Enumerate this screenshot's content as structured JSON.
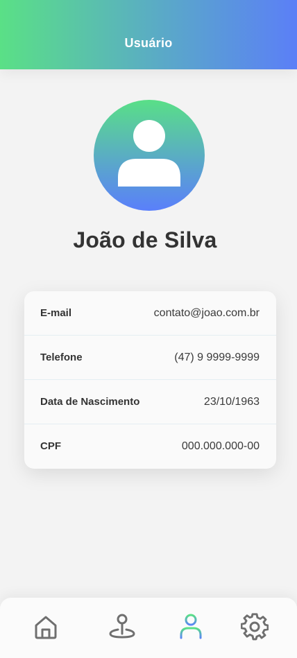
{
  "header": {
    "title": "Usuário"
  },
  "profile": {
    "avatar_icon": "user-avatar-icon",
    "name": "João de Silva"
  },
  "details": {
    "rows": [
      {
        "label": "E-mail",
        "value": "contato@joao.com.br"
      },
      {
        "label": "Telefone",
        "value": "(47) 9 9999-9999"
      },
      {
        "label": "Data de Nascimento",
        "value": "23/10/1963"
      },
      {
        "label": "CPF",
        "value": "000.000.000-00"
      }
    ]
  },
  "nav": {
    "items": [
      {
        "icon": "home-icon",
        "active": false
      },
      {
        "icon": "map-pin-icon",
        "active": false
      },
      {
        "icon": "user-icon",
        "active": true
      },
      {
        "icon": "gear-icon",
        "active": false
      }
    ]
  },
  "colors": {
    "gradient_start": "#5ae086",
    "gradient_end": "#5b7ff7",
    "icon_default": "#6f6f6f",
    "text_dark": "#333333"
  }
}
